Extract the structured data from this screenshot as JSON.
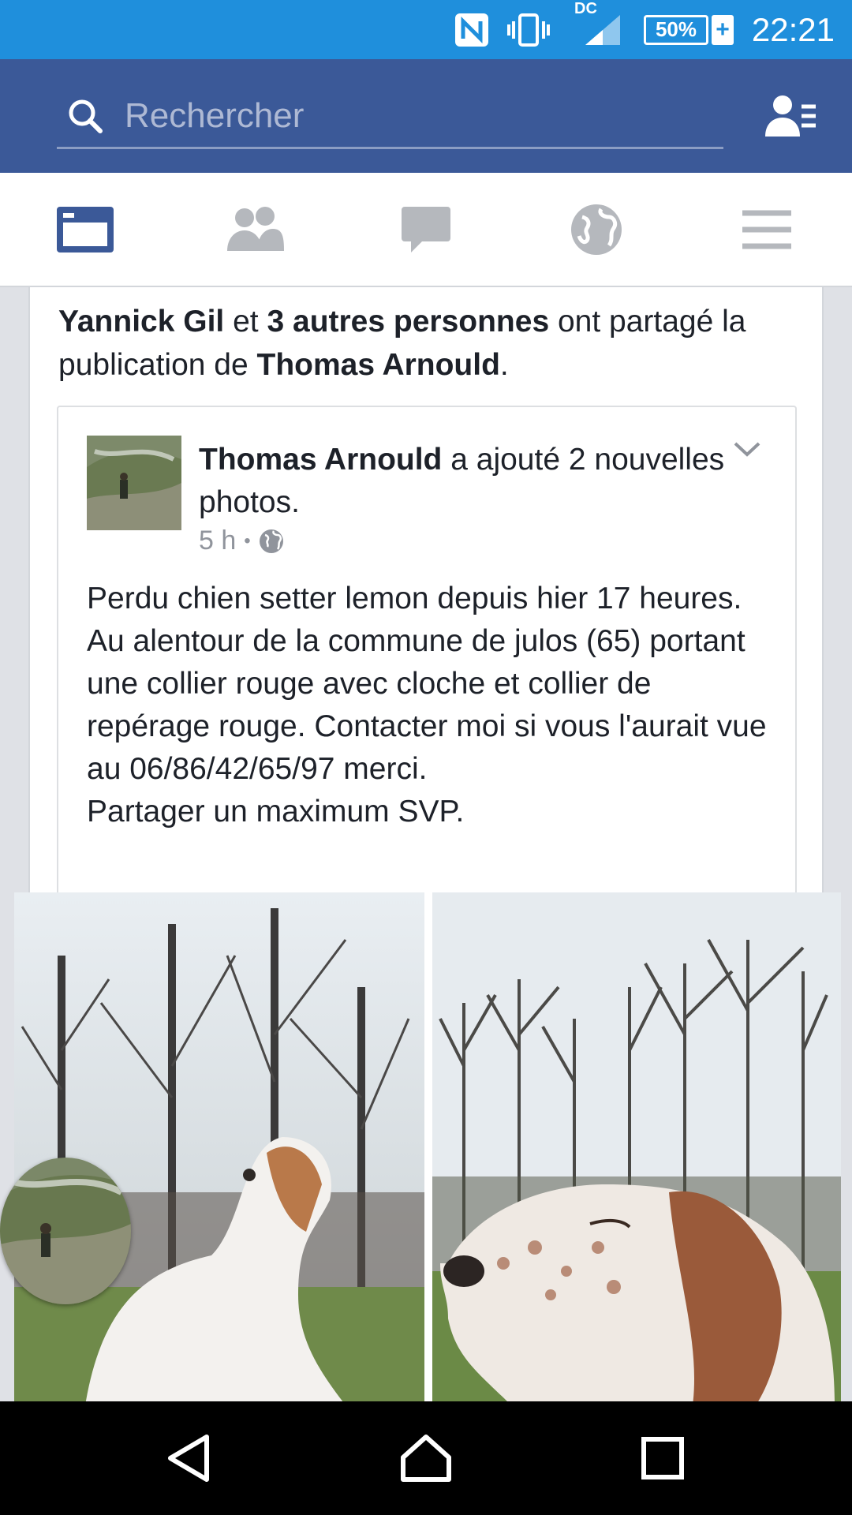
{
  "status_bar": {
    "time": "22:21",
    "battery_percent": "50%",
    "battery_charging_symbol": "+",
    "network_label": "DC",
    "icons": [
      "nfc-icon",
      "vibrate-icon",
      "signal-icon",
      "battery-icon"
    ]
  },
  "header": {
    "search_placeholder": "Rechercher",
    "colors": {
      "brand": "#3b5998",
      "status_bar": "#1f8fdc"
    }
  },
  "tabs": [
    {
      "name": "news-feed",
      "icon": "news-feed-icon",
      "active": true
    },
    {
      "name": "friends",
      "icon": "friends-icon",
      "active": false
    },
    {
      "name": "messages",
      "icon": "messages-icon",
      "active": false
    },
    {
      "name": "notifications",
      "icon": "globe-icon",
      "active": false
    },
    {
      "name": "menu",
      "icon": "hamburger-menu-icon",
      "active": false
    }
  ],
  "story": {
    "sharer": "Yannick Gil",
    "connector_et": "et",
    "others": "3 autres personnes",
    "action": "ont partagé la publication de",
    "original_author": "Thomas Arnould",
    "period": ".",
    "post": {
      "author": "Thomas Arnould",
      "action": "a ajouté 2 nouvelles photos.",
      "time": "5 h",
      "separator": "•",
      "privacy_icon": "public-globe-icon",
      "text": "Perdu chien setter lemon depuis hier 17 heures.\nAu alentour de la commune de julos (65) portant une collier rouge avec cloche et collier de repérage rouge. Contacter moi si vous l'aurait vue au 06/86/42/65/97 merci.\nPartager un maximum SVP."
    }
  },
  "nav": {
    "buttons": [
      "back-icon",
      "home-icon",
      "recents-icon"
    ]
  }
}
